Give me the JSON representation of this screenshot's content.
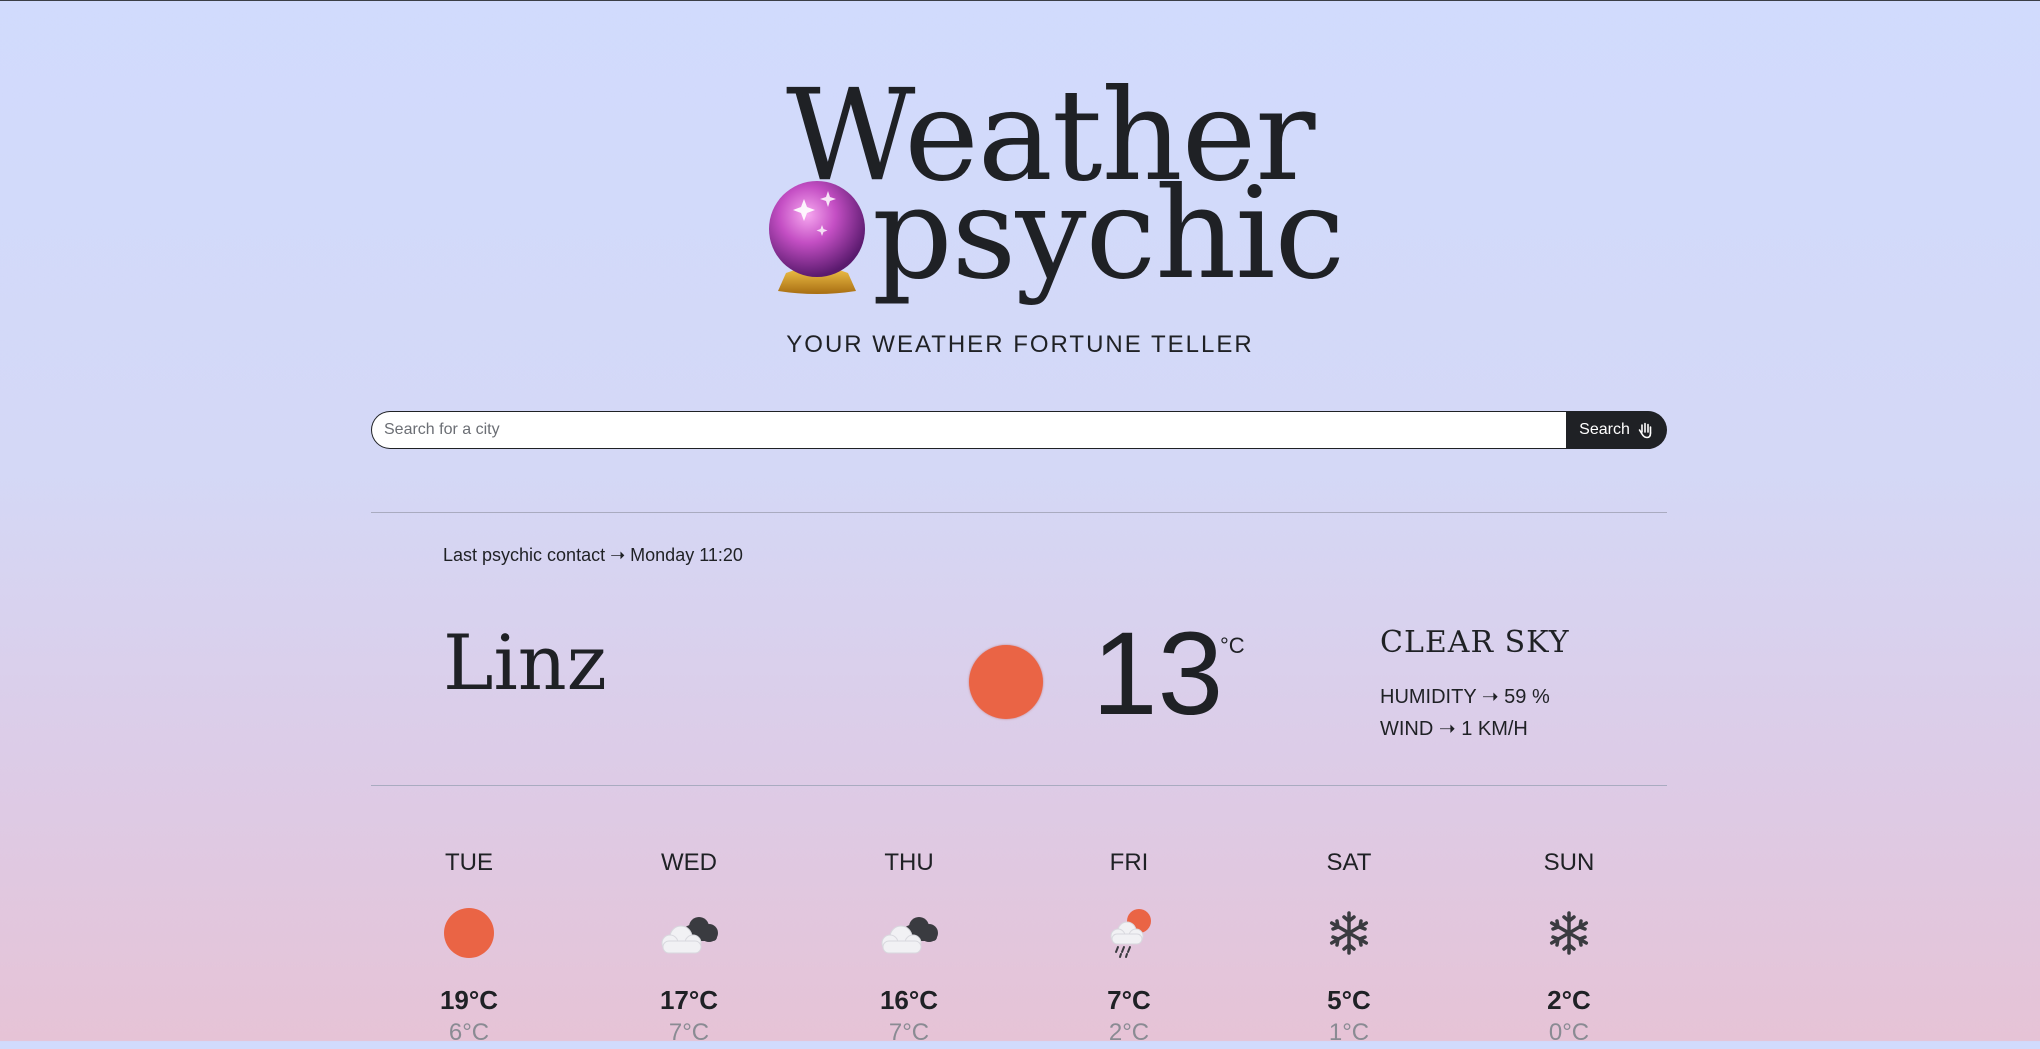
{
  "header": {
    "title_line1": "Weather",
    "title_line2": "psychic",
    "subtitle": "YOUR WEATHER FORTUNE TELLER",
    "logo_icon": "crystal-ball-icon"
  },
  "search": {
    "placeholder": "Search for a city",
    "value": "",
    "button_label": "Search",
    "button_icon": "raised-hand-icon"
  },
  "current": {
    "last_contact": "Last psychic contact ➝ Monday 11:20",
    "city": "Linz",
    "icon": "sun-icon",
    "temperature": "13",
    "unit": "°C",
    "condition": "CLEAR SKY",
    "humidity": "HUMIDITY ➝ 59 %",
    "wind": "WIND ➝ 1 KM/H"
  },
  "forecast": [
    {
      "day": "TUE",
      "icon": "sun-icon",
      "high": "19°C",
      "low": "6°C"
    },
    {
      "day": "WED",
      "icon": "clouds-icon",
      "high": "17°C",
      "low": "7°C"
    },
    {
      "day": "THU",
      "icon": "clouds-icon",
      "high": "16°C",
      "low": "7°C"
    },
    {
      "day": "FRI",
      "icon": "rain-sun-icon",
      "high": "7°C",
      "low": "2°C"
    },
    {
      "day": "SAT",
      "icon": "snowflake-icon",
      "high": "5°C",
      "low": "1°C"
    },
    {
      "day": "SUN",
      "icon": "snowflake-icon",
      "high": "2°C",
      "low": "0°C"
    }
  ],
  "colors": {
    "accent_sun": "#ea6445",
    "text": "#1f2125",
    "muted": "#8a8b93",
    "button_bg": "#1f2125"
  }
}
